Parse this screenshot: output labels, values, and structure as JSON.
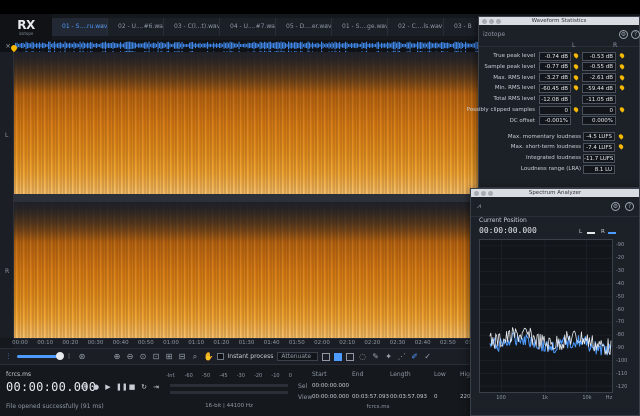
{
  "app": {
    "logo": "RX",
    "logo_sub": "izotope"
  },
  "tabs": [
    {
      "label": "01 - S....ru.wav",
      "active": true
    },
    {
      "label": "02 - U....#6.wav",
      "active": false
    },
    {
      "label": "03 - C(l...t).wav",
      "active": false
    },
    {
      "label": "04 - U....#7.wav",
      "active": false
    },
    {
      "label": "05 - D....er.wav",
      "active": false
    },
    {
      "label": "01 - S....ge.wav",
      "active": false
    },
    {
      "label": "02 - C....ls.wav",
      "active": false
    },
    {
      "label": "03 - B",
      "active": false
    }
  ],
  "channels": {
    "left": "L",
    "right": "R"
  },
  "time_ticks": [
    "00:00",
    "00:10",
    "00:20",
    "00:30",
    "00:40",
    "00:50",
    "01:00",
    "01:10",
    "01:20",
    "01:30",
    "01:40",
    "01:50",
    "02:00",
    "02:10",
    "02:20",
    "02:30",
    "02:40",
    "02:50",
    "03:00",
    "03:10",
    "03:20",
    "03:30",
    "03:40",
    "03:50",
    "hms"
  ],
  "toolbar": {
    "instant_process": "Instant process",
    "mode": "Attenuate",
    "zoom_fraction": 0.75
  },
  "bottom": {
    "file_name": "fcrcs.ms",
    "timecode": "00:00:00.000",
    "status": "File opened successfully (91 ms)",
    "meter_scale": [
      "-Inf.",
      "-60",
      "-50",
      "-45",
      "-30",
      "-20",
      "-10",
      "0"
    ],
    "meter_levels": [
      0.0,
      0.0
    ],
    "format": "16-bit | 44100 Hz",
    "sel_headers": {
      "start": "Start",
      "end": "End",
      "length": "Length"
    },
    "sel_rows": {
      "sel": "Sel",
      "view": "View"
    },
    "sel_values": {
      "sel_start": "00:00:00.000",
      "view_start": "00:00:00.000",
      "view_end": "00:03:57.093",
      "view_length": "00:03:57.093"
    },
    "sel_file": "fcrcs.ms",
    "freq_headers": {
      "low": "Low",
      "high": "Higl"
    },
    "freq_values": {
      "low": "0",
      "high": "220"
    },
    "hz_unit": "Hz"
  },
  "waveform_statistics": {
    "title": "Waveform Statistics",
    "header_logo": "izotope",
    "col_left": "L",
    "col_right": "R",
    "rows": [
      {
        "label": "True peak level",
        "l": "-0.74 dB",
        "r": "-0.53 dB",
        "pin": true
      },
      {
        "label": "Sample peak level",
        "l": "-0.77 dB",
        "r": "-0.55 dB",
        "pin": true
      },
      {
        "label": "Max. RMS level",
        "l": "-3.27 dB",
        "r": "-2.61 dB",
        "pin": true
      },
      {
        "label": "Min. RMS level",
        "l": "-60.45 dB",
        "r": "-59.44 dB",
        "pin": true
      },
      {
        "label": "Total RMS level",
        "l": "-12.08 dB",
        "r": "-11.05 dB",
        "pin": false
      },
      {
        "label": "Possibly clipped samples",
        "l": "0",
        "r": "0",
        "pin": true
      },
      {
        "label": "DC offset",
        "l": "-0.001%",
        "r": "0.000%",
        "pin": false
      }
    ],
    "loudness": [
      {
        "label": "Max. momentary loudness",
        "value": "-4.5 LUFS",
        "pin": true
      },
      {
        "label": "Max. short-term loudness",
        "value": "-7.4 LUFS",
        "pin": true
      },
      {
        "label": "Integrated loudness",
        "value": "-11.7 LUFS",
        "pin": false
      },
      {
        "label": "Loudness range (LRA)",
        "value": "8.1 LU",
        "pin": false
      }
    ]
  },
  "spectrum_analyzer": {
    "title": "Spectrum Analyzer",
    "current_position_label": "Current Position",
    "current_time": "00:00:00.000",
    "legend": [
      {
        "label": "L",
        "color": "#e6e9ee"
      },
      {
        "label": "R",
        "color": "#4d9bff"
      }
    ],
    "y_ticks": [
      "-90",
      "-20",
      "-30",
      "-40",
      "-50",
      "-60",
      "-70",
      "-80",
      "-90",
      "-100",
      "-110",
      "-120"
    ],
    "x_ticks": [
      "100",
      "1k",
      "10k",
      "Hz"
    ]
  },
  "colors": {
    "accent": "#4d9bff",
    "pin": "#f5b800",
    "spectrogram_hot": "#e38f1d"
  }
}
